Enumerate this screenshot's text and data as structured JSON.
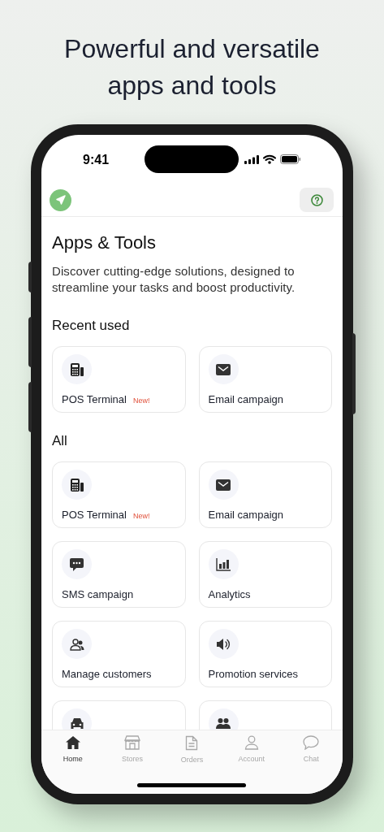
{
  "headline": [
    "Powerful and versatile",
    "apps and tools"
  ],
  "status_bar": {
    "time": "9:41"
  },
  "page": {
    "title": "Apps & Tools",
    "description": "Discover cutting-edge solutions, designed to streamline your tasks and boost productivity."
  },
  "sections": [
    {
      "title": "Recent used",
      "items": [
        {
          "kind": "pos",
          "label": "POS Terminal",
          "badge": "New!"
        },
        {
          "kind": "email",
          "label": "Email campaign"
        }
      ]
    },
    {
      "title": "All",
      "items": [
        {
          "kind": "pos",
          "label": "POS Terminal",
          "badge": "New!"
        },
        {
          "kind": "email",
          "label": "Email campaign"
        },
        {
          "kind": "sms",
          "label": "SMS campaign"
        },
        {
          "kind": "analytics",
          "label": "Analytics"
        },
        {
          "kind": "customers",
          "label": "Manage customers"
        },
        {
          "kind": "promotion",
          "label": "Promotion services"
        },
        {
          "kind": "car"
        },
        {
          "kind": "group"
        }
      ]
    }
  ],
  "tab_bar": [
    {
      "kind": "home",
      "label": "Home",
      "selected": true
    },
    {
      "kind": "stores",
      "label": "Stores",
      "selected": false
    },
    {
      "kind": "orders",
      "label": "Orders",
      "selected": false
    },
    {
      "kind": "account",
      "label": "Account",
      "selected": false
    },
    {
      "kind": "chat",
      "label": "Chat",
      "selected": false
    }
  ]
}
